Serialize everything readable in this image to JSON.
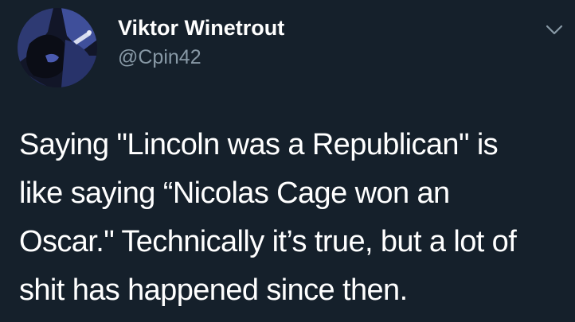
{
  "author": {
    "display_name": "Viktor Winetrout",
    "handle": "@Cpin42"
  },
  "tweet": {
    "lines": [
      "Saying \"Lincoln was a Republican\" is",
      "like saying “Nicolas Cage won an",
      "Oscar.\" Technically it’s true, but a lot of",
      "shit has happened since then."
    ]
  },
  "icons": {
    "menu": "chevron-down-icon"
  },
  "colors": {
    "background": "#15202b",
    "text": "#ffffff",
    "handle": "#8899a6"
  }
}
